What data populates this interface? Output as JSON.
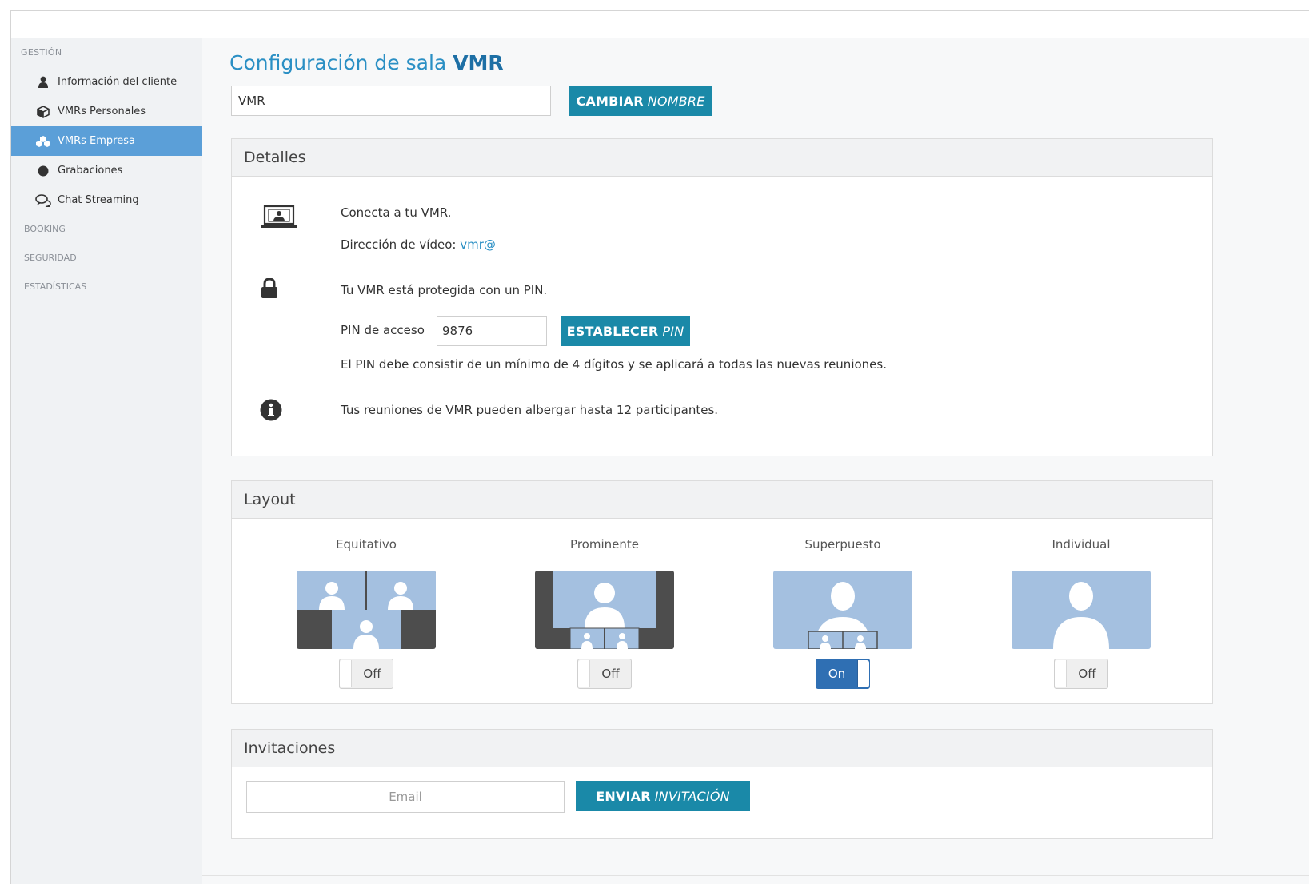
{
  "sidebar": {
    "section_gestion": "GESTIÓN",
    "items": [
      {
        "label": "Información del cliente",
        "icon": "user-icon"
      },
      {
        "label": "VMRs Personales",
        "icon": "cube-icon"
      },
      {
        "label": "VMRs Empresa",
        "icon": "cubes-icon",
        "active": true
      },
      {
        "label": "Grabaciones",
        "icon": "record-dot-icon"
      },
      {
        "label": "Chat Streaming",
        "icon": "chat-bubbles-icon"
      }
    ],
    "section_booking": "BOOKING",
    "section_seguridad": "SEGURIDAD",
    "section_estadisticas": "ESTADÍSTICAS"
  },
  "header": {
    "title_prefix": "Configuración de sala",
    "title_strong": "VMR"
  },
  "name_field": {
    "value": "VMR",
    "button_bold": "CAMBIAR",
    "button_italic": "NOMBRE"
  },
  "details": {
    "heading": "Detalles",
    "connect_text": "Conecta a tu VMR.",
    "video_address_label": "Dirección de vídeo:",
    "video_address_value": "vmr@",
    "pin_protected_text": "Tu VMR está protegida con un PIN.",
    "pin_label": "PIN de acceso",
    "pin_value": "9876",
    "pin_button_bold": "ESTABLECER",
    "pin_button_italic": "PIN",
    "pin_help": "El PIN debe consistir de un mínimo de 4 dígitos y se aplicará a todas las nuevas reuniones.",
    "participants_text": "Tus reuniones de VMR pueden albergar hasta 12 participantes."
  },
  "layout": {
    "heading": "Layout",
    "options": [
      {
        "label": "Equitativo",
        "toggle": "Off",
        "on": false
      },
      {
        "label": "Prominente",
        "toggle": "Off",
        "on": false
      },
      {
        "label": "Superpuesto",
        "toggle": "On",
        "on": true
      },
      {
        "label": "Individual",
        "toggle": "Off",
        "on": false
      }
    ]
  },
  "invitations": {
    "heading": "Invitaciones",
    "email_placeholder": "Email",
    "button_bold": "ENVIAR",
    "button_italic": "INVITACIÓN"
  },
  "colors": {
    "accent": "#1a89a8",
    "title": "#2a8fc4",
    "sidebar_active": "#5b9fd8",
    "toggle_on": "#2f6fb3",
    "thumb_blue": "#a4c0e0",
    "thumb_dark": "#4d4d4d"
  }
}
